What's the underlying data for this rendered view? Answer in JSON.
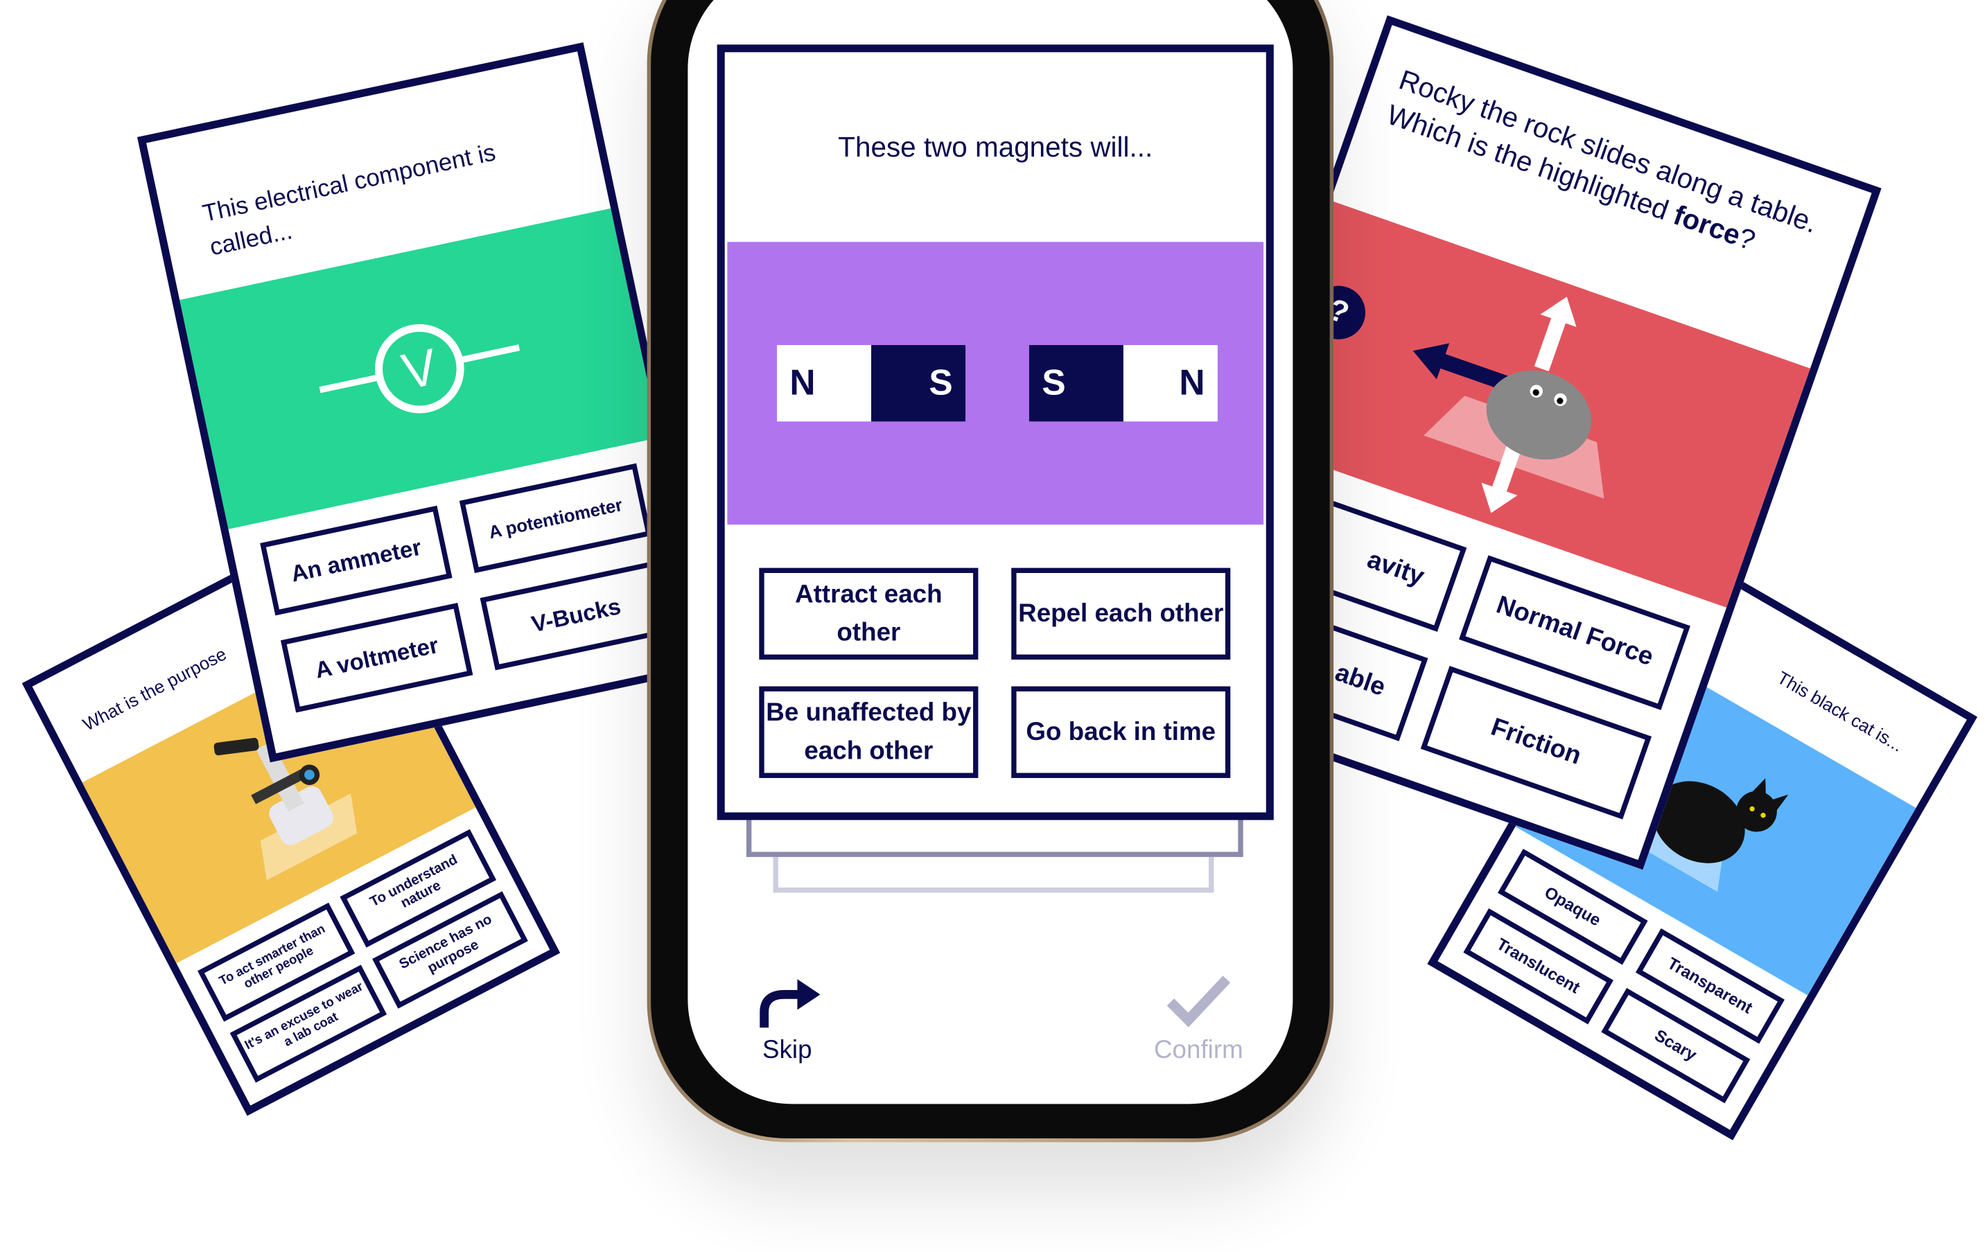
{
  "colors": {
    "navy": "#0a0a4e",
    "green": "#25d695",
    "purple": "#b174ef",
    "red": "#e2545d",
    "yellow": "#f2c14e",
    "blue": "#5cb3fb",
    "confirm_disabled": "#b3b3cc"
  },
  "main_card": {
    "question": "These two magnets will...",
    "magnets": [
      {
        "left": "N",
        "right": "S"
      },
      {
        "left": "S",
        "right": "N"
      }
    ],
    "answers": [
      "Attract each other",
      "Repel each other",
      "Be unaffected by each other",
      "Go back in time"
    ]
  },
  "footer": {
    "skip_label": "Skip",
    "skip_icon": "redo-arrow-icon",
    "confirm_label": "Confirm",
    "confirm_icon": "check-icon",
    "confirm_enabled": false
  },
  "cards": {
    "electrical": {
      "question": "This electrical component is called...",
      "symbol": "V",
      "answers": [
        "An ammeter",
        "A potentiometer",
        "A voltmeter",
        "V-Bucks"
      ]
    },
    "microscope": {
      "question": "What is the purpose",
      "answers": [
        "To act smarter than other people",
        "To understand nature",
        "It's an excuse to wear a lab coat",
        "Science has no purpose"
      ]
    },
    "rock": {
      "question_prefix": "Rocky the rock slides along a table. Which is the highlighted ",
      "question_bold": "force",
      "question_suffix": "?",
      "badge": "?",
      "answers": [
        "avity",
        "Normal Force",
        "able",
        "Friction"
      ]
    },
    "cat": {
      "question": "This black cat is...",
      "answers": [
        "Opaque",
        "Transparent",
        "Translucent",
        "Scary"
      ]
    }
  }
}
